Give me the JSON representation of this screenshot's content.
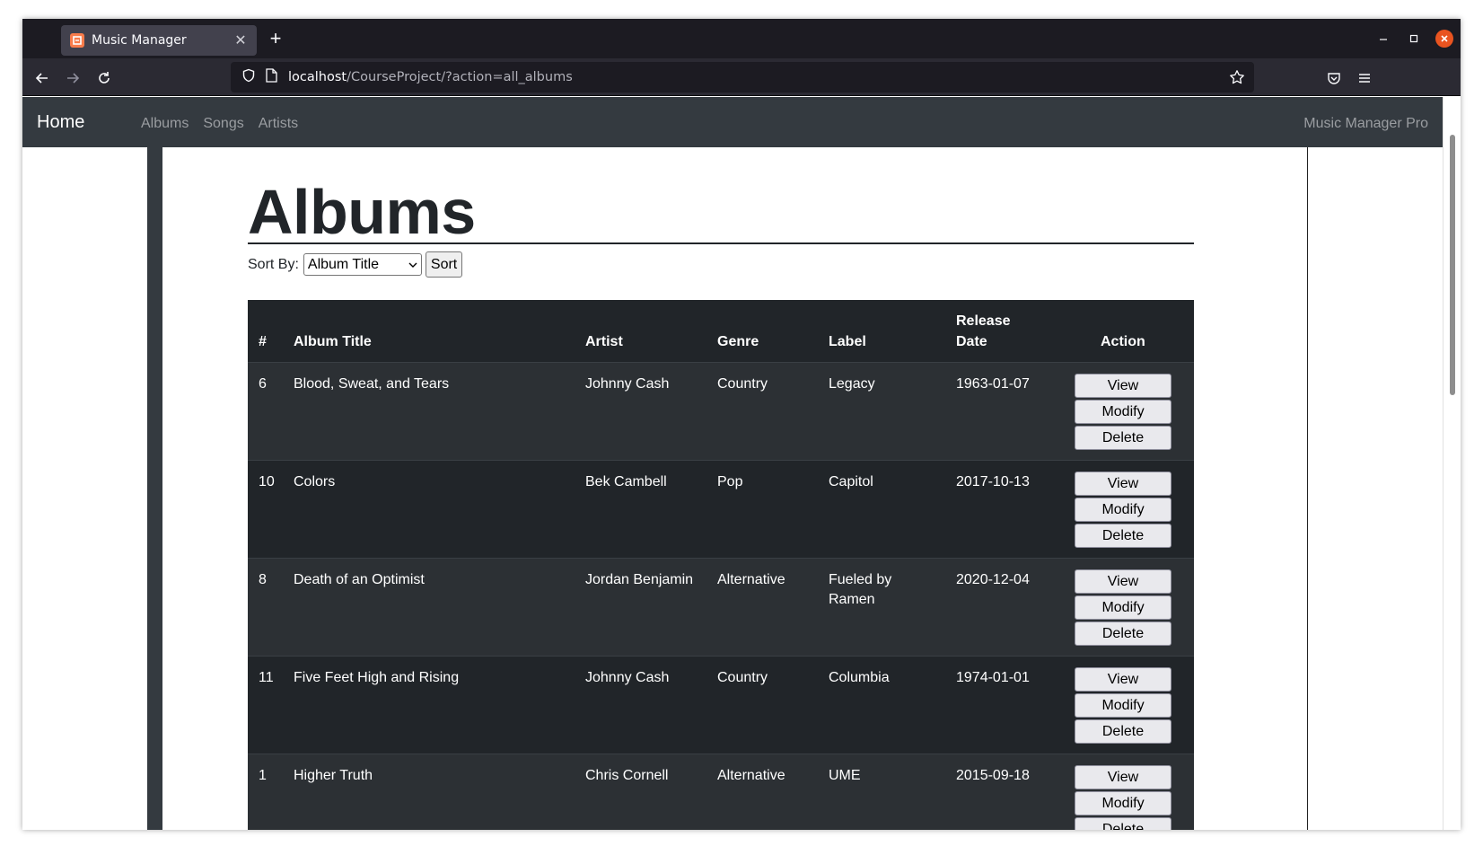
{
  "browser": {
    "tab_title": "Music Manager",
    "url_host": "localhost",
    "url_path": "/CourseProject/?action=all_albums"
  },
  "app": {
    "brand": "Home",
    "nav_links": [
      "Albums",
      "Songs",
      "Artists"
    ],
    "right_text": "Music Manager Pro"
  },
  "page": {
    "title": "Albums",
    "sort_label": "Sort By:",
    "sort_selected": "Album Title",
    "sort_button": "Sort"
  },
  "table": {
    "headers": {
      "num": "#",
      "title": "Album Title",
      "artist": "Artist",
      "genre": "Genre",
      "label": "Label",
      "release_1": "Release",
      "release_2": "Date",
      "action": "Action"
    },
    "action_labels": {
      "view": "View",
      "modify": "Modify",
      "delete": "Delete"
    },
    "rows": [
      {
        "num": "6",
        "title": "Blood, Sweat, and Tears",
        "artist": "Johnny Cash",
        "genre": "Country",
        "label": "Legacy",
        "date": "1963-01-07"
      },
      {
        "num": "10",
        "title": "Colors",
        "artist": "Bek Cambell",
        "genre": "Pop",
        "label": "Capitol",
        "date": "2017-10-13"
      },
      {
        "num": "8",
        "title": "Death of an Optimist",
        "artist": "Jordan Benjamin",
        "genre": "Alternative",
        "label": "Fueled by",
        "label2": "Ramen",
        "date": "2020-12-04"
      },
      {
        "num": "11",
        "title": "Five Feet High and Rising",
        "artist": "Johnny Cash",
        "genre": "Country",
        "label": "Columbia",
        "date": "1974-01-01"
      },
      {
        "num": "1",
        "title": "Higher Truth",
        "artist": "Chris Cornell",
        "genre": "Alternative",
        "label": "UME",
        "date": "2015-09-18"
      }
    ]
  },
  "icons": {
    "back": "arrow-left-icon",
    "forward": "arrow-right-icon",
    "reload": "reload-icon",
    "shield": "shield-icon",
    "page": "page-icon",
    "star": "star-icon",
    "pocket": "pocket-icon",
    "menu": "hamburger-icon"
  }
}
